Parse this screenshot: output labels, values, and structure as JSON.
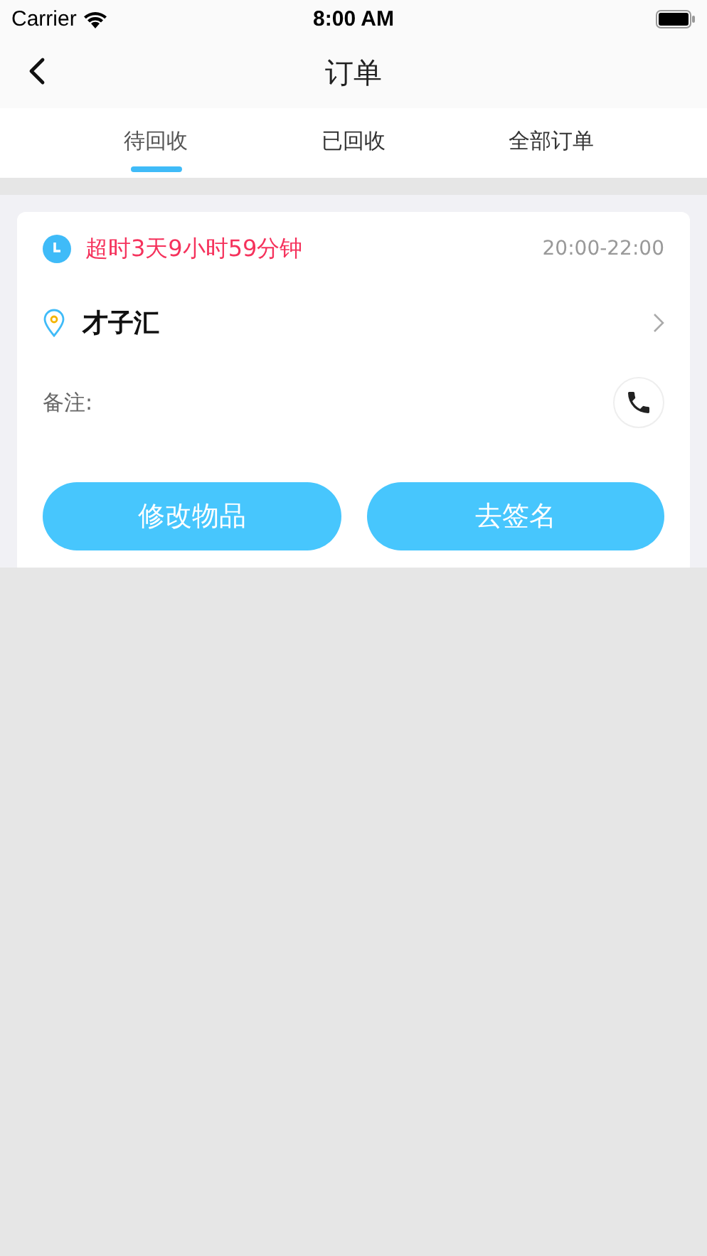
{
  "status_bar": {
    "carrier": "Carrier",
    "time": "8:00 AM"
  },
  "nav": {
    "title": "订单"
  },
  "tabs": [
    {
      "label": "待回收",
      "selected": true
    },
    {
      "label": "已回收",
      "selected": false
    },
    {
      "label": "全部订单",
      "selected": false
    }
  ],
  "orders": [
    {
      "overdue": "超时3天9小时59分钟",
      "time_slot": "20:00-22:00",
      "place": "才子汇",
      "note_label": "备注:",
      "buttons": [
        "修改物品",
        "去签名"
      ]
    }
  ]
}
